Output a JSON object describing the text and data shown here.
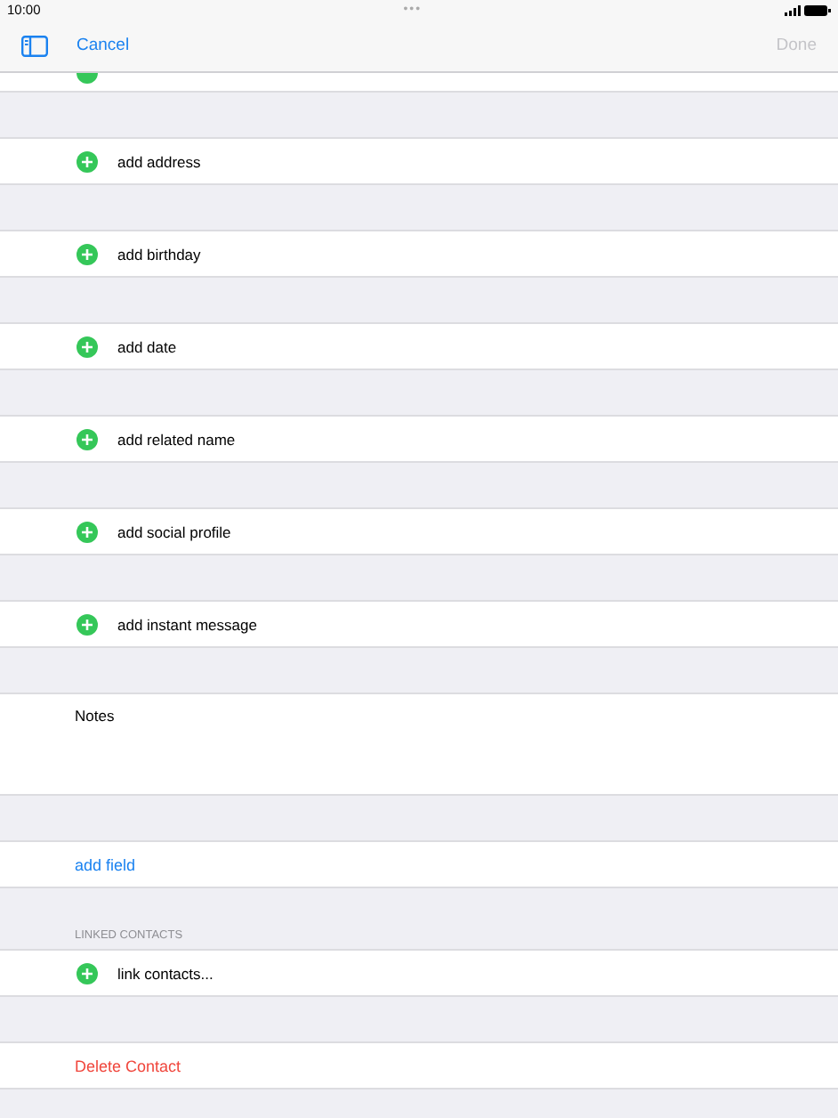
{
  "status_bar": {
    "time": "10:00",
    "dots": "•••"
  },
  "nav": {
    "cancel": "Cancel",
    "done": {
      "label": "Done",
      "disabled": true
    }
  },
  "rows": [
    {
      "kind": "partial"
    },
    {
      "kind": "gap"
    },
    {
      "kind": "add",
      "label": "add address"
    },
    {
      "kind": "gap"
    },
    {
      "kind": "add",
      "label": "add birthday"
    },
    {
      "kind": "gap"
    },
    {
      "kind": "add",
      "label": "add date"
    },
    {
      "kind": "gap"
    },
    {
      "kind": "add",
      "label": "add related name"
    },
    {
      "kind": "gap"
    },
    {
      "kind": "add",
      "label": "add social profile"
    },
    {
      "kind": "gap"
    },
    {
      "kind": "add",
      "label": "add instant message"
    },
    {
      "kind": "gap"
    },
    {
      "kind": "notes",
      "label": "Notes"
    },
    {
      "kind": "gap"
    },
    {
      "kind": "link",
      "label": "add field"
    },
    {
      "kind": "header",
      "label": "LINKED CONTACTS"
    },
    {
      "kind": "add",
      "label": "link contacts..."
    },
    {
      "kind": "gap"
    },
    {
      "kind": "delete",
      "label": "Delete Contact"
    }
  ]
}
